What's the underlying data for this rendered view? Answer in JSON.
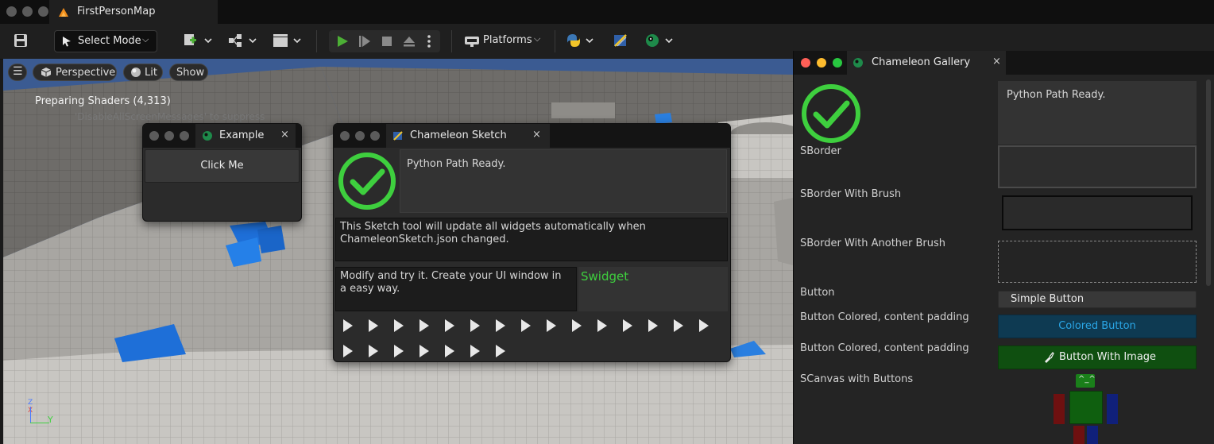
{
  "window": {
    "tab_title": "FirstPersonMap"
  },
  "toolbar": {
    "select_mode_label": "Select Mode",
    "platforms_label": "Platforms"
  },
  "viewport": {
    "perspective_label": "Perspective",
    "lit_label": "Lit",
    "show_label": "Show",
    "shader_message": "Preparing Shaders (4,313)",
    "shader_sub": "'DisableAllScreenMessages' to suppress",
    "axis": {
      "z": "Z",
      "x": "X",
      "y": "Y"
    }
  },
  "example_window": {
    "title": "Example",
    "close": "×",
    "button_label": "Click Me"
  },
  "sketch_window": {
    "title": "Chameleon Sketch",
    "close": "×",
    "python_status": "Python Path Ready.",
    "description": "This Sketch tool will update all widgets automatically when ChameleonSketch.json changed.",
    "modify_text": "Modify and try it. Create your UI window in a easy way.",
    "swidget_label": "Swidget"
  },
  "gallery_window": {
    "title": "Chameleon Gallery",
    "close": "×",
    "python_status": "Python Path Ready.",
    "labels": {
      "sborder": "SBorder",
      "sborder_brush": "SBorder With Brush",
      "sborder_another": "SBorder With Another Brush",
      "button": "Button",
      "button_colored_1": "Button Colored, content padding",
      "button_colored_2": "Button Colored, content padding",
      "scanvas": "SCanvas with Buttons"
    },
    "simple_button": "Simple Button",
    "colored_button": "Colored Button",
    "image_button": "Button With Image",
    "canvas_face": "^_^"
  },
  "colors": {
    "accent_green": "#3ecf3e",
    "play_green": "#4caf35",
    "colored_button_bg": "#0e3a52",
    "colored_button_text": "#2aa6e6",
    "image_button_bg": "#0f4f10",
    "swidget_text": "#3ecf3e",
    "unreal_orange": "#f08c1a"
  }
}
